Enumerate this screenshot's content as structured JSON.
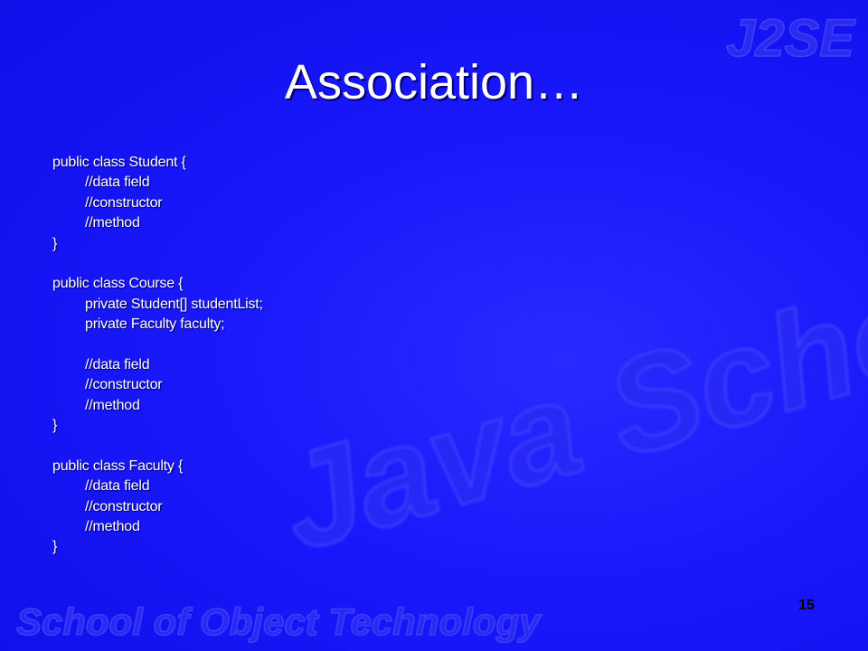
{
  "slide": {
    "title": "Association…",
    "page_number": "15",
    "code_lines": [
      {
        "text": "public class Student {",
        "indent": false
      },
      {
        "text": "//data field",
        "indent": true
      },
      {
        "text": "//constructor",
        "indent": true
      },
      {
        "text": "//method",
        "indent": true
      },
      {
        "text": "}",
        "indent": false
      },
      {
        "text": "",
        "indent": false
      },
      {
        "text": "public class Course {",
        "indent": false
      },
      {
        "text": "private Student[] studentList;",
        "indent": true
      },
      {
        "text": "private Faculty faculty;",
        "indent": true
      },
      {
        "text": "",
        "indent": false
      },
      {
        "text": "//data field",
        "indent": true
      },
      {
        "text": "//constructor",
        "indent": true
      },
      {
        "text": "//method",
        "indent": true
      },
      {
        "text": "}",
        "indent": false
      },
      {
        "text": "",
        "indent": false
      },
      {
        "text": "public class Faculty {",
        "indent": false
      },
      {
        "text": "//data field",
        "indent": true
      },
      {
        "text": "//constructor",
        "indent": true
      },
      {
        "text": "//method",
        "indent": true
      },
      {
        "text": "}",
        "indent": false
      }
    ]
  },
  "watermarks": {
    "corner_logo": "J2SE",
    "center_logo": "Java School",
    "footer_logo": "School of Object Technology"
  },
  "colors": {
    "background": "#1414ff",
    "text": "#ffffff",
    "page_number": "#000000",
    "watermark": "#3a3aff"
  }
}
